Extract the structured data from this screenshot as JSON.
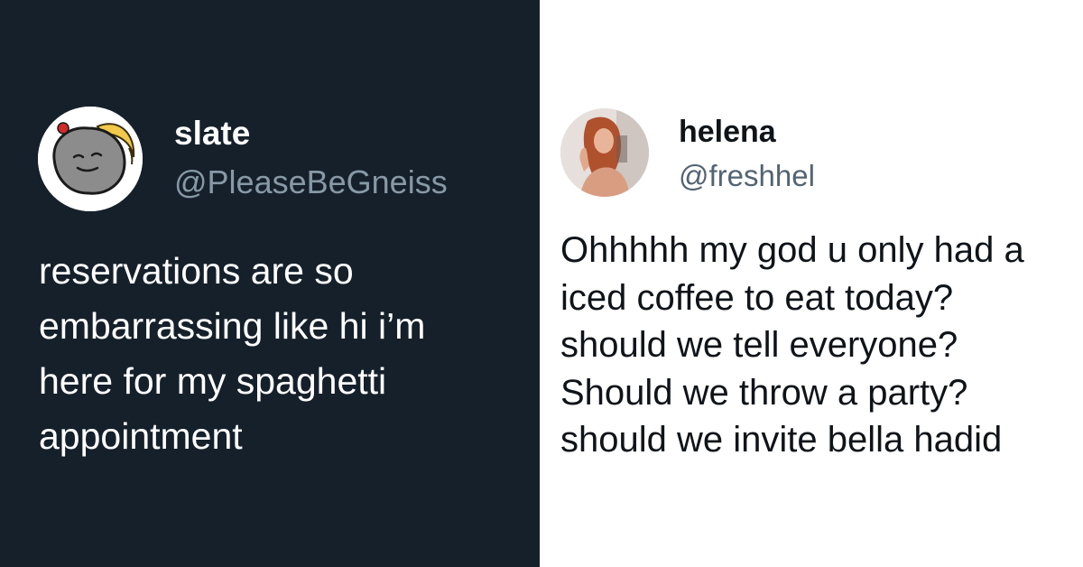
{
  "tweets": [
    {
      "display_name": "slate",
      "handle": "@PleaseBeGneiss",
      "text": "reservations are so\nembarrassing like hi i’m\nhere for my spaghetti\nappointment",
      "avatar_icon": "rock-with-banana-avatar-icon",
      "theme": "dark",
      "background_color": "#15202b"
    },
    {
      "display_name": "helena",
      "handle": "@freshhel",
      "text": "Ohhhhh my god u only had a\niced coffee to eat today?\nshould we tell everyone?\nShould we throw a party?\nshould we invite bella hadid",
      "avatar_icon": "profile-photo-avatar-icon",
      "theme": "light",
      "background_color": "#ffffff"
    }
  ]
}
